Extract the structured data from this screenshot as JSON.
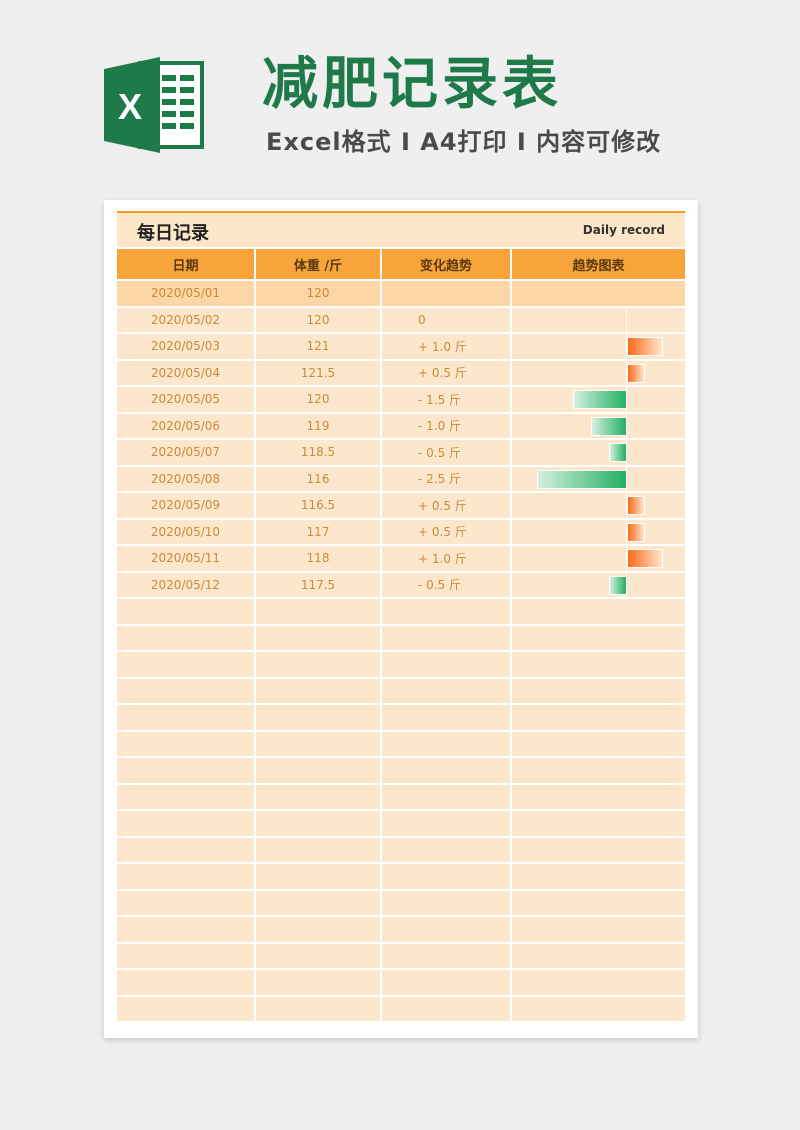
{
  "header": {
    "title": "减肥记录表",
    "subtitle": "Excel格式 I A4打印 I 内容可修改",
    "brand_color": "#1f7a4a"
  },
  "section": {
    "title": "每日记录",
    "title_en": "Daily record"
  },
  "table": {
    "columns": [
      "日期",
      "体重 /斤",
      "变化趋势",
      "趋势图表"
    ],
    "rows": [
      {
        "date": "2020/05/01",
        "weight": "120",
        "change": "",
        "delta": 0
      },
      {
        "date": "2020/05/02",
        "weight": "120",
        "change": "0",
        "delta": 0
      },
      {
        "date": "2020/05/03",
        "weight": "121",
        "change": "+ 1.0 斤",
        "delta": 1.0
      },
      {
        "date": "2020/05/04",
        "weight": "121.5",
        "change": "+ 0.5 斤",
        "delta": 0.5
      },
      {
        "date": "2020/05/05",
        "weight": "120",
        "change": "-  1.5 斤",
        "delta": -1.5
      },
      {
        "date": "2020/05/06",
        "weight": "119",
        "change": "-  1.0 斤",
        "delta": -1.0
      },
      {
        "date": "2020/05/07",
        "weight": "118.5",
        "change": "-  0.5 斤",
        "delta": -0.5
      },
      {
        "date": "2020/05/08",
        "weight": "116",
        "change": "-  2.5 斤",
        "delta": -2.5
      },
      {
        "date": "2020/05/09",
        "weight": "116.5",
        "change": "+ 0.5 斤",
        "delta": 0.5
      },
      {
        "date": "2020/05/10",
        "weight": "117",
        "change": "+ 0.5 斤",
        "delta": 0.5
      },
      {
        "date": "2020/05/11",
        "weight": "118",
        "change": "+ 1.0 斤",
        "delta": 1.0
      },
      {
        "date": "2020/05/12",
        "weight": "117.5",
        "change": "-  0.5 斤",
        "delta": -0.5
      }
    ],
    "empty_rows": 16,
    "colors": {
      "header": "#f7a43a",
      "cell": "#fde7cc",
      "first_row": "#fdd6a6",
      "increase": "#ff6a1a",
      "decrease": "#22b063"
    }
  }
}
